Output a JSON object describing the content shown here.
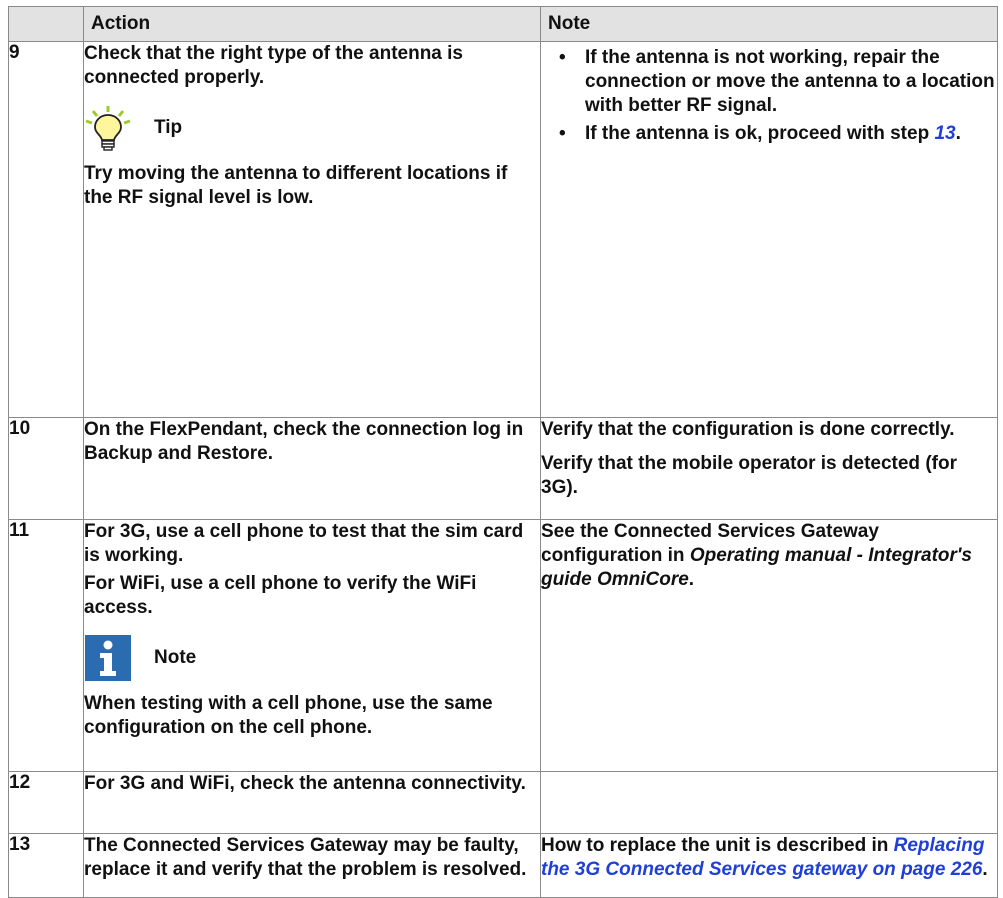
{
  "headers": {
    "step": "",
    "action": "Action",
    "note": "Note"
  },
  "rows": {
    "r9": {
      "num": "9",
      "action_p1": "Check that the right type of the antenna is connected properly.",
      "tip_label": "Tip",
      "tip_text": "Try moving the antenna to different locations if the RF signal level is low.",
      "note_b1": "If the antenna is not working, repair the connection or move the antenna to a location with better RF signal.",
      "note_b2_pre": "If the antenna is ok, proceed with step ",
      "note_b2_link": "13",
      "note_b2_post": "."
    },
    "r10": {
      "num": "10",
      "action_pre": "On the FlexPendant, check the connection log in ",
      "action_bold": "Backup and Restore",
      "action_post": ".",
      "note_p1": "Verify that the configuration is done correctly.",
      "note_p2": "Verify that the mobile operator is detected (for 3G)."
    },
    "r11": {
      "num": "11",
      "action_p1": "For 3G, use a cell phone to test that the sim card is working.",
      "action_p2": "For WiFi, use a cell phone to verify the WiFi access.",
      "note_label": "Note",
      "note_callout_text": "When testing with a cell phone, use the same configuration on the cell phone.",
      "note_pre": "See the Connected Services Gateway configuration in ",
      "note_italic": "Operating manual - Integrator's guide OmniCore",
      "note_post": "."
    },
    "r12": {
      "num": "12",
      "action_p1": "For 3G and WiFi, check the antenna connectivity.",
      "note": ""
    },
    "r13": {
      "num": "13",
      "action_p1": "The Connected Services Gateway may be faulty, replace it and verify that the problem is resolved.",
      "note_pre": "How to replace the unit is described in ",
      "note_link": "Replacing the 3G Connected Services gateway on page 226",
      "note_post": "."
    }
  },
  "icons": {
    "tip": "lightbulb-icon",
    "note": "info-icon"
  },
  "colors": {
    "header_bg": "#e2e2e2",
    "link": "#1f3fd8",
    "info_icon_bg": "#2b6cb0",
    "bulb": "#fff59d"
  }
}
